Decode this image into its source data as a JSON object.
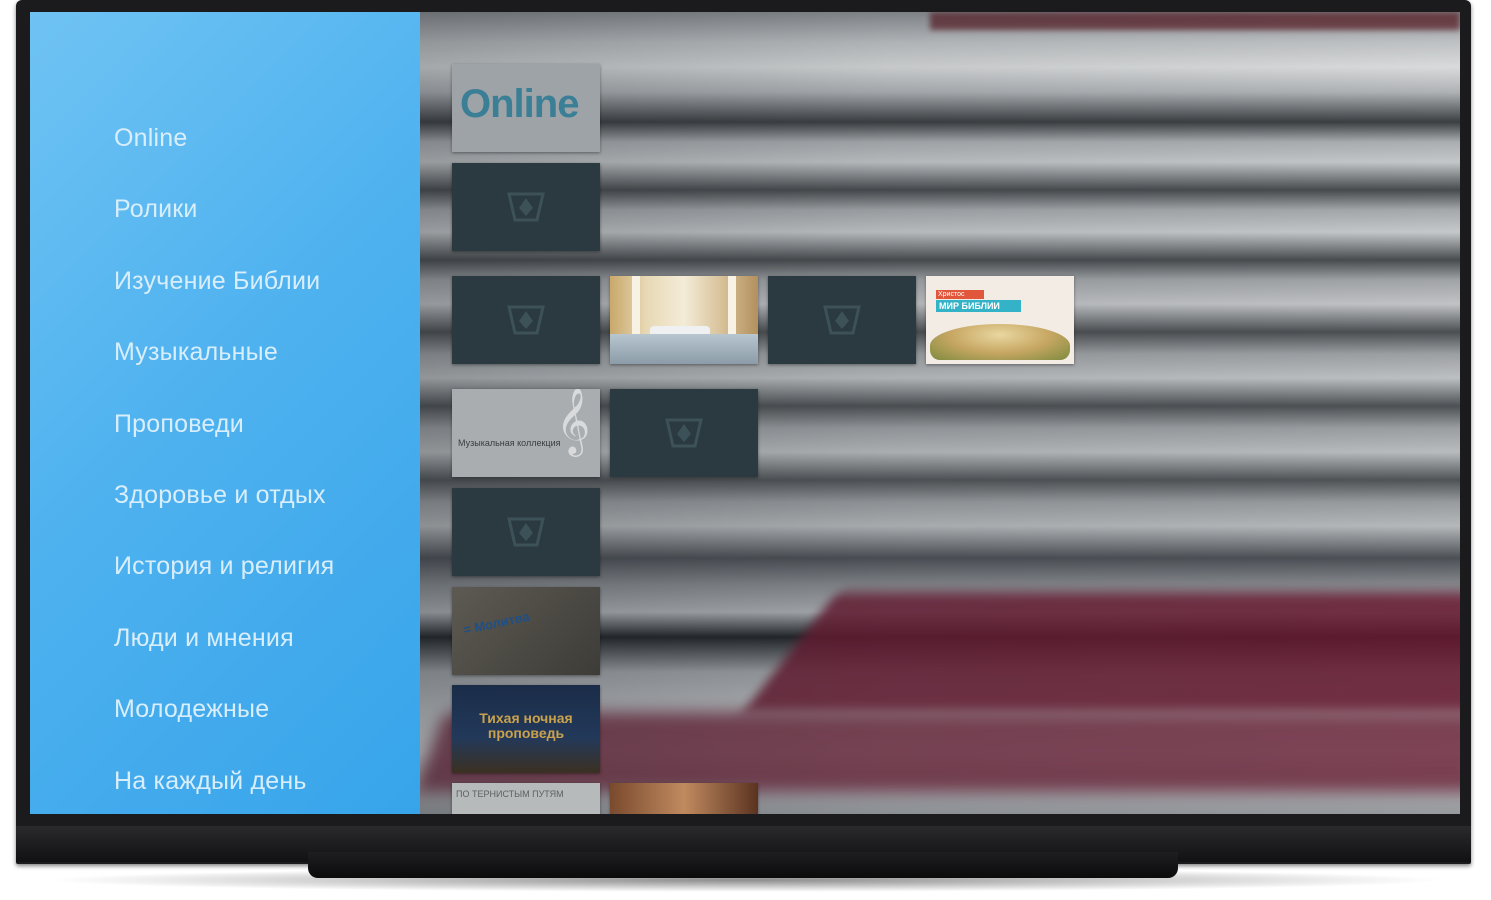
{
  "menu": {
    "items": [
      {
        "label": "Online"
      },
      {
        "label": "Ролики"
      },
      {
        "label": "Изучение Библии"
      },
      {
        "label": "Музыкальные"
      },
      {
        "label": "Проповеди"
      },
      {
        "label": "Здоровье и отдых"
      },
      {
        "label": "История и религия"
      },
      {
        "label": "Люди и мнения"
      },
      {
        "label": "Молодежные"
      },
      {
        "label": "На каждый день"
      }
    ]
  },
  "tiles": {
    "online": {
      "text": "Online"
    },
    "bible": {
      "tag_top": "Христос",
      "tag_main": "МИР БИБЛИИ"
    },
    "music": {
      "text": "Музыкальная коллекция"
    },
    "quote": {
      "text": "= Молитва"
    },
    "night": {
      "text": "Тихая ночная проповедь"
    },
    "tour": {
      "text": "ПО ТЕРНИСТЫМ ПУТЯМ"
    }
  },
  "colors": {
    "sidebar_accent": "#4fb2ef",
    "menu_text": "#d9eefb",
    "placeholder_tile": "#2b3a40"
  },
  "icons": {
    "placeholder_logo": "channel-logo-icon",
    "music_clef": "treble-clef-icon"
  }
}
